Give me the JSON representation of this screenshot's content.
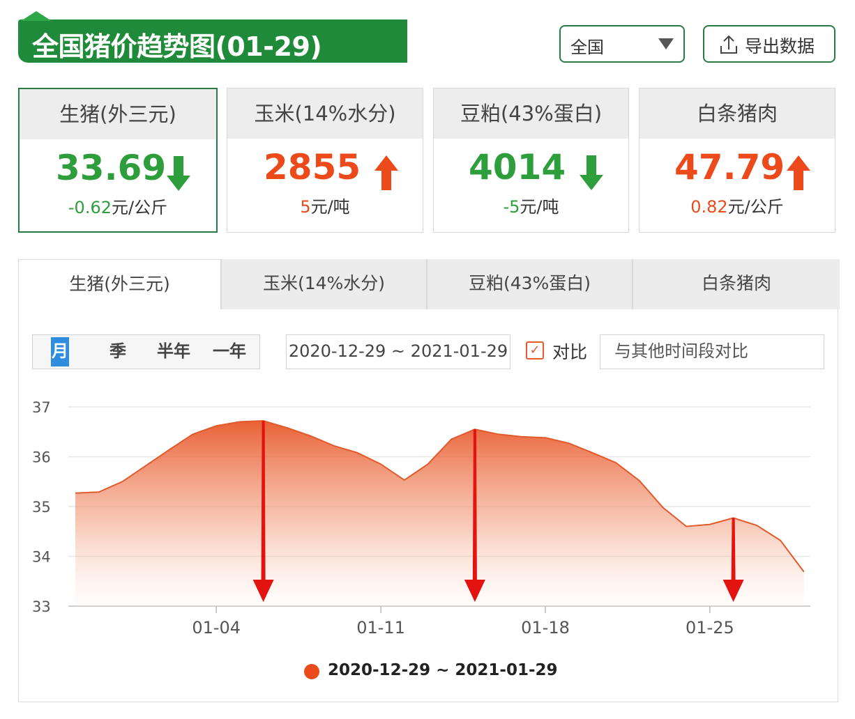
{
  "header": {
    "title": "全国猪价趋势图(01-29)",
    "region_select": {
      "value": "全国"
    },
    "export_button": {
      "label": "导出数据",
      "icon": "upload-icon"
    }
  },
  "cards": [
    {
      "name": "生猪(外三元)",
      "price": "33.69",
      "direction": "down",
      "change_value": "-0.62",
      "change_unit": "元/公斤",
      "color": "#2e9d3b"
    },
    {
      "name": "玉米(14%水分)",
      "price": "2855",
      "direction": "up",
      "change_value": "5",
      "change_unit": "元/吨",
      "color": "#ec4a1a"
    },
    {
      "name": "豆粕(43%蛋白)",
      "price": "4014",
      "direction": "down",
      "change_value": "-5",
      "change_unit": "元/吨",
      "color": "#2e9d3b"
    },
    {
      "name": "白条猪肉",
      "price": "47.79",
      "direction": "up",
      "change_value": "0.82",
      "change_unit": "元/公斤",
      "color": "#ec4a1a"
    }
  ],
  "tabs": [
    "生猪(外三元)",
    "玉米(14%水分)",
    "豆粕(43%蛋白)",
    "白条猪肉"
  ],
  "active_tab": 0,
  "period_options": [
    "月",
    "季",
    "半年",
    "一年"
  ],
  "selected_period": "月",
  "date_range": "2020-12-29 ~ 2021-01-29",
  "compare": {
    "checked": true,
    "label": "对比",
    "placeholder": "与其他时间段对比"
  },
  "chart_data": {
    "type": "area",
    "ylim": [
      33,
      37
    ],
    "yticks": [
      33,
      34,
      35,
      36,
      37
    ],
    "xtick_labels": [
      "01-04",
      "01-11",
      "01-18",
      "01-25"
    ],
    "grid": true,
    "legend": "bottom",
    "series": [
      {
        "name": "2020-12-29 ~ 2021-01-29",
        "color": "#ec4a1a",
        "x": [
          "12-29",
          "12-30",
          "12-31",
          "01-01",
          "01-02",
          "01-03",
          "01-04",
          "01-05",
          "01-06",
          "01-07",
          "01-08",
          "01-09",
          "01-10",
          "01-11",
          "01-12",
          "01-13",
          "01-14",
          "01-15",
          "01-16",
          "01-17",
          "01-18",
          "01-19",
          "01-20",
          "01-21",
          "01-22",
          "01-23",
          "01-24",
          "01-25",
          "01-26",
          "01-27",
          "01-28",
          "01-29"
        ],
        "values": [
          35.27,
          35.29,
          35.5,
          35.82,
          36.14,
          36.45,
          36.62,
          36.7,
          36.72,
          36.58,
          36.42,
          36.22,
          36.08,
          35.85,
          35.53,
          35.85,
          36.35,
          36.55,
          36.45,
          36.4,
          36.38,
          36.27,
          36.08,
          35.88,
          35.52,
          34.98,
          34.6,
          34.64,
          34.77,
          34.62,
          34.32,
          33.69
        ]
      }
    ],
    "annotations": [
      {
        "type": "down-arrow",
        "x": "01-06"
      },
      {
        "type": "down-arrow",
        "x": "01-15"
      },
      {
        "type": "down-arrow",
        "x": "01-26"
      }
    ]
  }
}
